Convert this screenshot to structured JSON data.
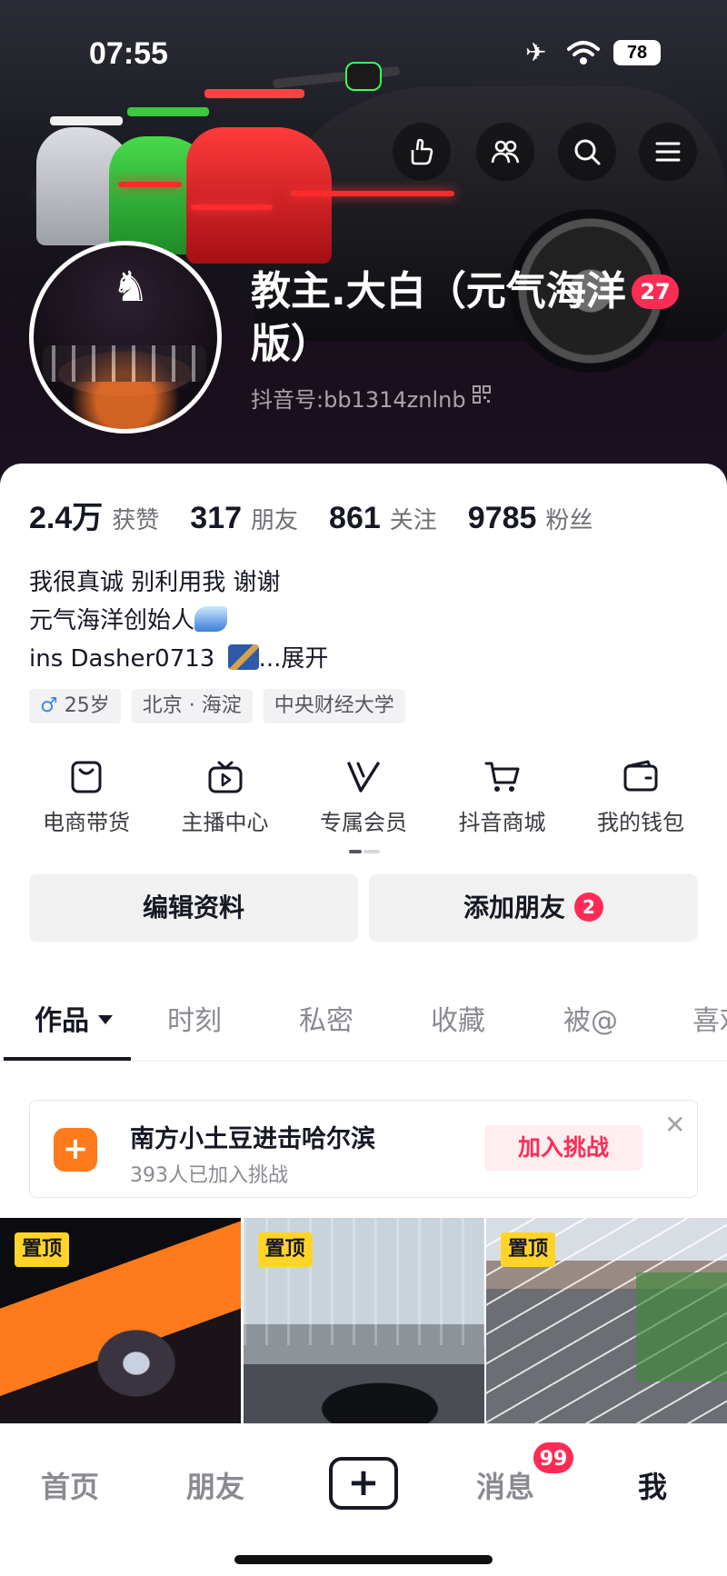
{
  "status_bar": {
    "time": "07:55",
    "battery": "78"
  },
  "profile": {
    "name": "教主.大白（元气海洋版）",
    "name_line1": "教主.大白（元气海洋",
    "name_line2": "版）",
    "name_badge": "27",
    "douyin_id": "抖音号:bb1314znlnb"
  },
  "stats": [
    {
      "value": "2.4万",
      "label": "获赞"
    },
    {
      "value": "317",
      "label": "朋友"
    },
    {
      "value": "861",
      "label": "关注"
    },
    {
      "value": "9785",
      "label": "粉丝"
    }
  ],
  "bio": {
    "line1": "我很真诚 别利用我 谢谢",
    "line2": "元气海洋创始人",
    "line3": "ins Dasher0713 ",
    "expand": "...展开"
  },
  "tags": {
    "gender_age": "25岁",
    "location": "北京 · 海淀",
    "school": "中央财经大学"
  },
  "services": [
    {
      "label": "电商带货",
      "icon": "bag-icon"
    },
    {
      "label": "主播中心",
      "icon": "tv-icon"
    },
    {
      "label": "专属会员",
      "icon": "vip-v-icon"
    },
    {
      "label": "抖音商城",
      "icon": "cart-icon"
    },
    {
      "label": "我的钱包",
      "icon": "wallet-icon"
    }
  ],
  "actions": {
    "edit_profile": "编辑资料",
    "add_friend": "添加朋友",
    "add_friend_badge": "2"
  },
  "tabs": [
    "作品",
    "时刻",
    "私密",
    "收藏",
    "被@",
    "喜欢"
  ],
  "challenge": {
    "title": "南方小土豆进击哈尔滨",
    "subtitle": "393人已加入挑战",
    "button": "加入挑战",
    "close": "✕"
  },
  "videos": [
    {
      "pin_label": "置顶"
    },
    {
      "pin_label": "置顶"
    },
    {
      "pin_label": "置顶"
    }
  ],
  "bottom_nav": {
    "home": "首页",
    "friends": "朋友",
    "create": "+",
    "messages": "消息",
    "messages_badge": "99",
    "me": "我"
  },
  "colors": {
    "accent": "#fe2c55",
    "pin": "#ffd42a",
    "challenge_icon": "#ff7a1a"
  }
}
